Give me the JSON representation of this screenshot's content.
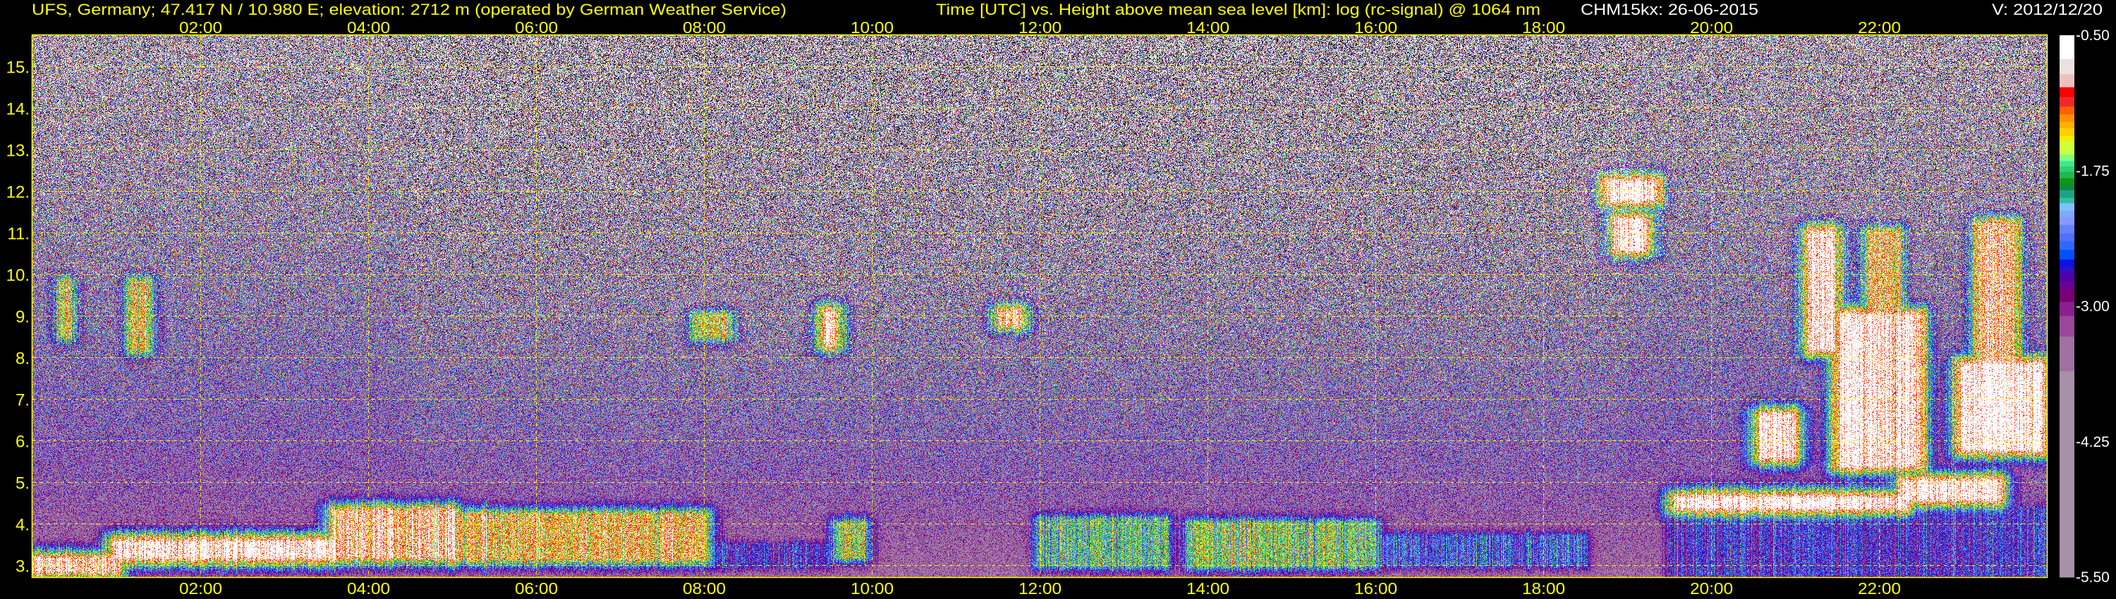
{
  "header": {
    "station": "UFS, Germany; 47.417 N / 10.980 E; elevation: 2712 m  (operated by German Weather Service)",
    "description": "Time [UTC] vs. Height above mean sea level [km]: log (rc-signal) @ 1064 nm",
    "instrument_date": "CHM15kx: 26-06-2015",
    "version": "V: 2012/12/20"
  },
  "colors": {
    "axis_text": "#ffff00",
    "grid": "#ffff00",
    "header_white": "#ffffff",
    "background": "#000000",
    "below_range": "#000000"
  },
  "chart_data": {
    "type": "heatmap",
    "title": "Time [UTC] vs. Height above mean sea level [km]: log (rc-signal) @ 1064 nm",
    "xlabel": "Time [UTC]",
    "ylabel": "Height above mean sea level [km]",
    "xlim_hours": [
      0,
      24
    ],
    "ylim_km": [
      2.712,
      15.74
    ],
    "x_ticks": [
      {
        "value": 2,
        "label": "02:00"
      },
      {
        "value": 4,
        "label": "04:00"
      },
      {
        "value": 6,
        "label": "06:00"
      },
      {
        "value": 8,
        "label": "08:00"
      },
      {
        "value": 10,
        "label": "10:00"
      },
      {
        "value": 12,
        "label": "12:00"
      },
      {
        "value": 14,
        "label": "14:00"
      },
      {
        "value": 16,
        "label": "16:00"
      },
      {
        "value": 18,
        "label": "18:00"
      },
      {
        "value": 20,
        "label": "20:00"
      },
      {
        "value": 22,
        "label": "22:00"
      }
    ],
    "y_ticks": [
      {
        "value": 3,
        "label": "3."
      },
      {
        "value": 4,
        "label": "4."
      },
      {
        "value": 5,
        "label": "5."
      },
      {
        "value": 6,
        "label": "6."
      },
      {
        "value": 7,
        "label": "7."
      },
      {
        "value": 8,
        "label": "8."
      },
      {
        "value": 9,
        "label": "9."
      },
      {
        "value": 10,
        "label": "10."
      },
      {
        "value": 11,
        "label": "11."
      },
      {
        "value": 12,
        "label": "12."
      },
      {
        "value": 13,
        "label": "13."
      },
      {
        "value": 14,
        "label": "14."
      },
      {
        "value": 15,
        "label": "15."
      }
    ],
    "grid": "dashed",
    "colorbar": {
      "range": [
        -5.5,
        -0.5
      ],
      "ticks": [
        {
          "value": -0.5,
          "label": "-0.50"
        },
        {
          "value": -1.75,
          "label": "-1.75"
        },
        {
          "value": -3.0,
          "label": "-3.00"
        },
        {
          "value": -4.25,
          "label": "-4.25"
        },
        {
          "value": -5.5,
          "label": "-5.50"
        }
      ],
      "levels": [
        {
          "min": -0.72,
          "color": "#ffffff"
        },
        {
          "min": -0.86,
          "color": "#ece0e0"
        },
        {
          "min": -0.98,
          "color": "#f0c0c0"
        },
        {
          "min": -1.07,
          "color": "#ff0000"
        },
        {
          "min": -1.16,
          "color": "#f02828"
        },
        {
          "min": -1.23,
          "color": "#ff6000"
        },
        {
          "min": -1.3,
          "color": "#ff9000"
        },
        {
          "min": -1.36,
          "color": "#ffb000"
        },
        {
          "min": -1.43,
          "color": "#ffd000"
        },
        {
          "min": -1.48,
          "color": "#f0f000"
        },
        {
          "min": -1.6,
          "color": "#d0ff40"
        },
        {
          "min": -1.66,
          "color": "#80ff80"
        },
        {
          "min": -1.71,
          "color": "#40e890"
        },
        {
          "min": -1.76,
          "color": "#30d070"
        },
        {
          "min": -1.82,
          "color": "#20b850"
        },
        {
          "min": -1.87,
          "color": "#109810"
        },
        {
          "min": -1.93,
          "color": "#108840"
        },
        {
          "min": -2.0,
          "color": "#20a088"
        },
        {
          "min": -2.05,
          "color": "#30c0a0"
        },
        {
          "min": -2.12,
          "color": "#80c0ff"
        },
        {
          "min": -2.18,
          "color": "#80a8ff"
        },
        {
          "min": -2.25,
          "color": "#8898ff"
        },
        {
          "min": -2.33,
          "color": "#6880ff"
        },
        {
          "min": -2.4,
          "color": "#5070ff"
        },
        {
          "min": -2.48,
          "color": "#3068ff"
        },
        {
          "min": -2.57,
          "color": "#0050ff"
        },
        {
          "min": -2.64,
          "color": "#1010e0"
        },
        {
          "min": -2.69,
          "color": "#3010c0"
        },
        {
          "min": -2.77,
          "color": "#5000a8"
        },
        {
          "min": -2.85,
          "color": "#6a0098"
        },
        {
          "min": -2.96,
          "color": "#780070"
        },
        {
          "min": -3.09,
          "color": "#8a2090"
        },
        {
          "min": -3.28,
          "color": "#984898"
        },
        {
          "min": -3.6,
          "color": "#a070a0"
        },
        {
          "min": -5.5,
          "color": "#a890a8"
        }
      ]
    },
    "layers": [
      {
        "t": [
          0.0,
          1.0
        ],
        "h": [
          2.85,
          3.15
        ],
        "value": -0.8
      },
      {
        "t": [
          1.0,
          3.6
        ],
        "h": [
          3.2,
          3.55
        ],
        "value": -0.6
      },
      {
        "t": [
          3.6,
          5.0
        ],
        "h": [
          3.2,
          4.3
        ],
        "value": -0.9
      },
      {
        "t": [
          5.0,
          8.0
        ],
        "h": [
          3.15,
          4.2
        ],
        "value": -1.25
      },
      {
        "t": [
          8.0,
          9.5
        ],
        "h": [
          2.95,
          3.5
        ],
        "value": -2.7
      },
      {
        "t": [
          9.6,
          9.9
        ],
        "h": [
          3.2,
          4.0
        ],
        "value": -1.6
      },
      {
        "t": [
          12.0,
          13.5
        ],
        "h": [
          3.0,
          4.1
        ],
        "value": -1.9
      },
      {
        "t": [
          13.8,
          16.0
        ],
        "h": [
          3.0,
          4.0
        ],
        "value": -1.7
      },
      {
        "t": [
          16.0,
          18.5
        ],
        "h": [
          3.0,
          3.7
        ],
        "value": -2.4
      },
      {
        "t": [
          19.5,
          24.0
        ],
        "h": [
          2.75,
          4.35
        ],
        "value": -2.65
      },
      {
        "t": [
          19.6,
          22.3
        ],
        "h": [
          4.4,
          4.6
        ],
        "value": -0.5
      },
      {
        "t": [
          22.3,
          23.4
        ],
        "h": [
          4.6,
          5.0
        ],
        "value": -0.5
      },
      {
        "t": [
          18.8,
          19.3
        ],
        "h": [
          11.8,
          12.2
        ],
        "value": -0.5
      },
      {
        "t": [
          18.9,
          19.2
        ],
        "h": [
          10.6,
          11.3
        ],
        "value": -0.6
      },
      {
        "t": [
          21.2,
          21.45
        ],
        "h": [
          8.2,
          11.0
        ],
        "value": -0.7
      },
      {
        "t": [
          20.6,
          20.95
        ],
        "h": [
          5.6,
          6.6
        ],
        "value": -0.6
      },
      {
        "t": [
          21.55,
          22.45
        ],
        "h": [
          5.4,
          9.0
        ],
        "value": -0.55
      },
      {
        "t": [
          21.9,
          22.2
        ],
        "h": [
          8.5,
          11.0
        ],
        "value": -1.1
      },
      {
        "t": [
          23.0,
          23.9
        ],
        "h": [
          5.8,
          7.8
        ],
        "value": -0.5
      },
      {
        "t": [
          23.2,
          23.6
        ],
        "h": [
          7.8,
          11.2
        ],
        "value": -1.0
      },
      {
        "t": [
          9.45,
          9.55
        ],
        "h": [
          8.3,
          9.1
        ],
        "value": -0.8
      },
      {
        "t": [
          11.55,
          11.75
        ],
        "h": [
          8.8,
          9.1
        ],
        "value": -0.8
      },
      {
        "t": [
          1.2,
          1.35
        ],
        "h": [
          8.2,
          9.8
        ],
        "value": -1.3
      },
      {
        "t": [
          0.35,
          0.45
        ],
        "h": [
          8.5,
          9.8
        ],
        "value": -1.5
      },
      {
        "t": [
          7.9,
          8.3
        ],
        "h": [
          8.5,
          9.0
        ],
        "value": -1.6
      }
    ]
  }
}
